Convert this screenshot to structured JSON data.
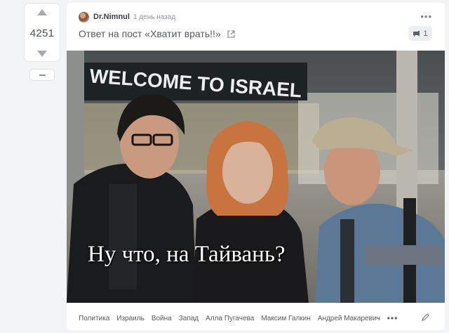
{
  "vote": {
    "rating": "4251",
    "up_icon": "arrow-up-icon",
    "down_icon": "arrow-down-icon",
    "minus_icon": "minus-icon"
  },
  "post": {
    "author": "Dr.Nimnul",
    "time": "1 день назад",
    "title": "Ответ на пост «Хватит врать!!»",
    "comments_count": "1",
    "image": {
      "sign_text": "WELCOME TO ISRAEL",
      "caption": "Ну что, на Тайвань?"
    },
    "tags": [
      "Политика",
      "Израиль",
      "Война",
      "Запад",
      "Алла Пугачева",
      "Максим Галкин",
      "Андрей Макаревич"
    ],
    "more_label": "•••"
  },
  "colors": {
    "card": "#ffffff",
    "background": "#f3f4f5",
    "text": "#565c61"
  }
}
